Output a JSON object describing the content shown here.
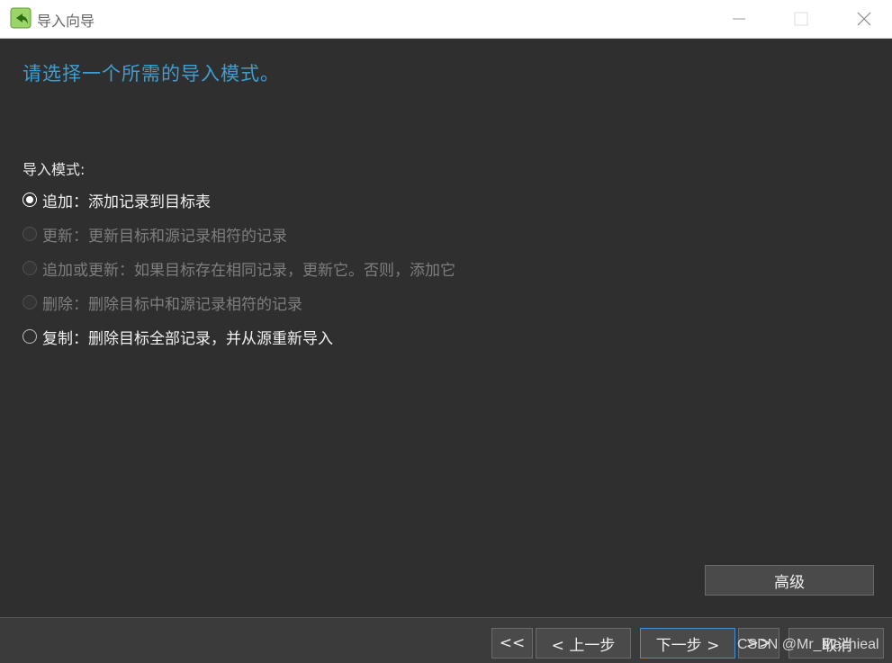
{
  "window": {
    "title": "导入向导",
    "icon": "import-wizard-icon"
  },
  "heading": "请选择一个所需的导入模式。",
  "mode_label": "导入模式:",
  "options": [
    {
      "label": "追加：添加记录到目标表",
      "checked": true,
      "enabled": true
    },
    {
      "label": "更新：更新目标和源记录相符的记录",
      "checked": false,
      "enabled": false
    },
    {
      "label": "追加或更新：如果目标存在相同记录，更新它。否则，添加它",
      "checked": false,
      "enabled": false
    },
    {
      "label": "删除：删除目标中和源记录相符的记录",
      "checked": false,
      "enabled": false
    },
    {
      "label": "复制：删除目标全部记录，并从源重新导入",
      "checked": false,
      "enabled": true
    }
  ],
  "buttons": {
    "advanced": "高级",
    "first": "<<",
    "back": "< 上一步",
    "next": "下一步 >",
    "last": ">>",
    "cancel": "取消"
  },
  "watermark": "CSDN @Mr_Machieal",
  "colors": {
    "heading": "#3f9ed1",
    "background": "#2f2f2f",
    "primary_border": "#3f8fd6"
  }
}
